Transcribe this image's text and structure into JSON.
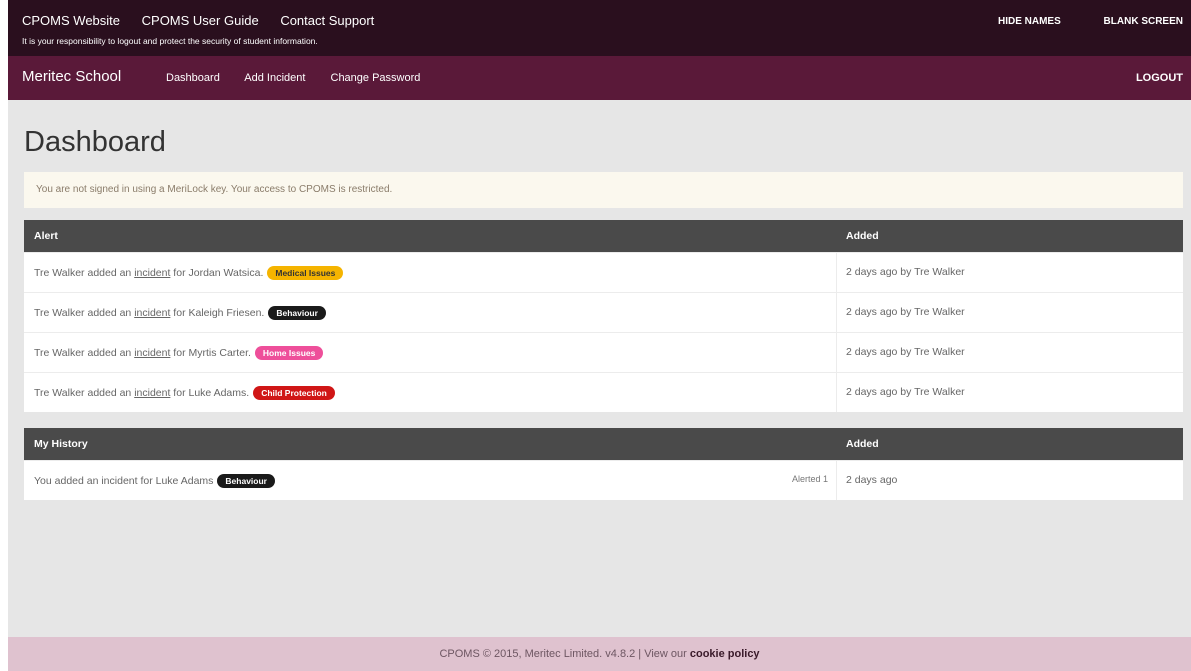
{
  "topbar": {
    "links": [
      "CPOMS Website",
      "CPOMS User Guide",
      "Contact Support"
    ],
    "note": "It is your responsibility to logout and protect the security of student information.",
    "right_links": [
      "HIDE NAMES",
      "BLANK SCREEN"
    ]
  },
  "navbar": {
    "brand": "Meritec School",
    "links": [
      "Dashboard",
      "Add Incident",
      "Change Password"
    ],
    "logout": "LOGOUT"
  },
  "page": {
    "title": "Dashboard",
    "notice": "You are not signed in using a MeriLock key. Your access to CPOMS is restricted."
  },
  "alerts": {
    "headers": [
      "Alert",
      "Added"
    ],
    "rows": [
      {
        "pre": "Tre Walker added an ",
        "link": "incident",
        "post": " for Jordan Watsica.",
        "badge": "Medical Issues",
        "added": "2 days ago by Tre Walker"
      },
      {
        "pre": "Tre Walker added an ",
        "link": "incident",
        "post": " for Kaleigh Friesen.",
        "badge": "Behaviour",
        "added": "2 days ago by Tre Walker"
      },
      {
        "pre": "Tre Walker added an ",
        "link": "incident",
        "post": " for Myrtis Carter.",
        "badge": "Home Issues",
        "added": "2 days ago by Tre Walker"
      },
      {
        "pre": "Tre Walker added an ",
        "link": "incident",
        "post": " for Luke Adams.",
        "badge": "Child Protection",
        "added": "2 days ago by Tre Walker"
      }
    ]
  },
  "history": {
    "headers": [
      "My History",
      "Added"
    ],
    "rows": [
      {
        "text": "You added an incident for Luke Adams",
        "badge": "Behaviour",
        "alerted": "Alerted 1",
        "added": "2 days ago"
      }
    ]
  },
  "footer": {
    "text": "CPOMS © 2015, Meritec Limited. v4.8.2 | View our ",
    "link": "cookie policy"
  },
  "colors": {
    "topbar_bg": "#2a0f1e",
    "navbar_bg": "#5a1939",
    "header_bg": "#4a4a4a",
    "footer_bg": "#dfc2cf",
    "badge_medical": "#f5b400",
    "badge_behaviour": "#1a1a1a",
    "badge_home": "#ee4f9a",
    "badge_child": "#d01616"
  }
}
